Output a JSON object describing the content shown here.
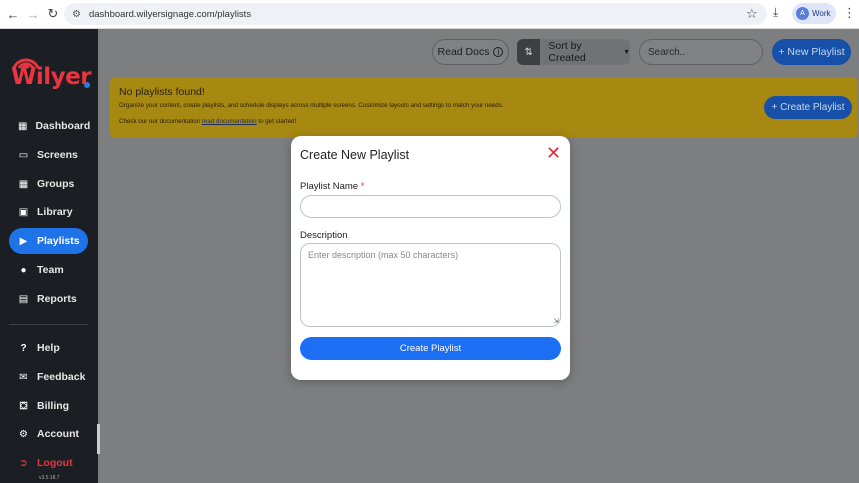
{
  "browser": {
    "url": "dashboard.wilyersignage.com/playlists",
    "profile_initial": "A",
    "profile_label": "Work"
  },
  "sidebar": {
    "logo_text": "Wilyer",
    "items": [
      {
        "label": "Dashboard",
        "icon": "dashboard-icon"
      },
      {
        "label": "Screens",
        "icon": "monitor-icon"
      },
      {
        "label": "Groups",
        "icon": "grid-icon"
      },
      {
        "label": "Library",
        "icon": "film-icon"
      },
      {
        "label": "Playlists",
        "icon": "playlist-icon",
        "active": true
      },
      {
        "label": "Team",
        "icon": "users-icon"
      },
      {
        "label": "Reports",
        "icon": "clipboard-icon"
      }
    ],
    "bottom_items": [
      {
        "label": "Help",
        "icon": "question-icon"
      },
      {
        "label": "Feedback",
        "icon": "chat-icon"
      },
      {
        "label": "Billing",
        "icon": "cart-icon"
      },
      {
        "label": "Account",
        "icon": "gear-icon"
      },
      {
        "label": "Logout",
        "icon": "logout-icon"
      }
    ],
    "version": "v3.5.18.7"
  },
  "toolbar": {
    "read_docs_label": "Read Docs",
    "sort_label": "Sort by Created",
    "search_placeholder": "Search..",
    "new_playlist_label": "+ New Playlist"
  },
  "banner": {
    "title": "No playlists found!",
    "description": "Organize your content, create playlists, and schedule displays across multiple screens. Customize layouts and settings to match your needs.",
    "doc_prefix": "Check our our documentation",
    "doc_link": "read documentation",
    "doc_suffix": "to get started!",
    "create_label": "+ Create Playlist"
  },
  "modal": {
    "title": "Create New Playlist",
    "name_label": "Playlist Name",
    "name_required_mark": "*",
    "name_value": "",
    "description_label": "Description",
    "description_placeholder": "Enter description (max 50 characters)",
    "submit_label": "Create Playlist"
  },
  "colors": {
    "accent": "#1c6ef2",
    "brand_red": "#ea3440",
    "sidebar_bg": "#1b1e22",
    "banner_bg": "#f5c518"
  }
}
